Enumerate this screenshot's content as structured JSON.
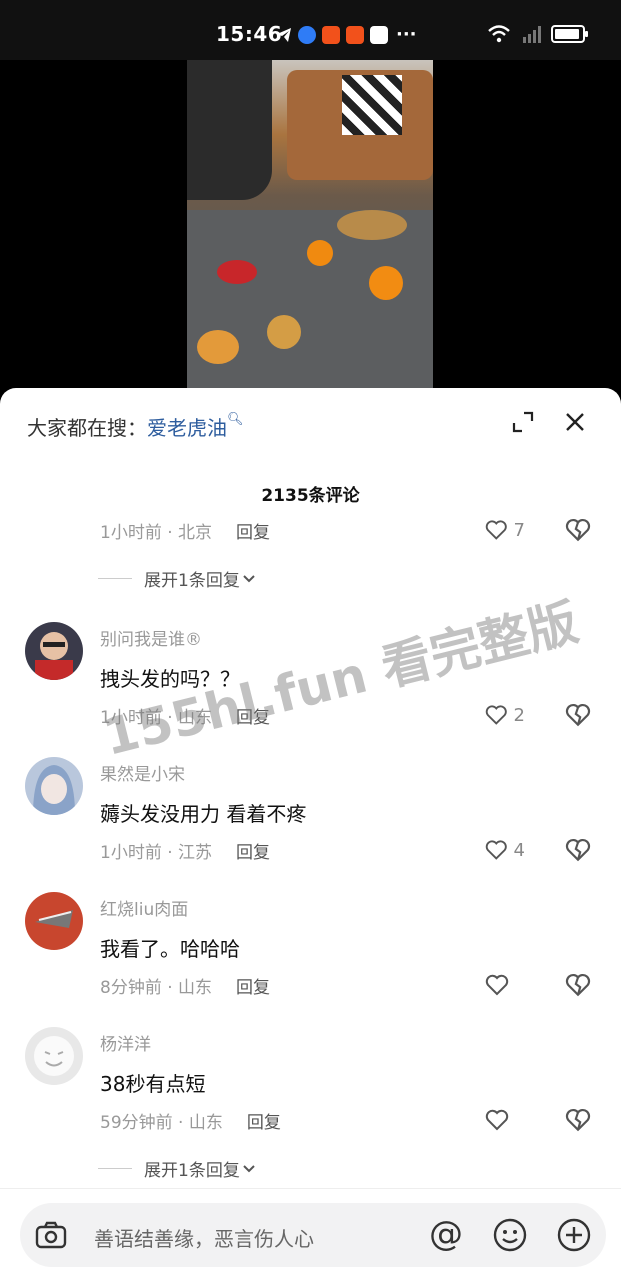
{
  "status_bar": {
    "time": "15:46",
    "more": "···"
  },
  "search": {
    "prefix": "大家都在搜：",
    "keyword": "爱老虎油",
    "search_icon": "search-icon"
  },
  "comment_count": "2135条评论",
  "prev_comment": {
    "time": "1小时前",
    "location": "北京",
    "reply": "回复",
    "likes": "7",
    "expand": "展开1条回复"
  },
  "comments": [
    {
      "username": "别问我是谁®",
      "text": "拽头发的吗？？",
      "time": "1小时前",
      "location": "山东",
      "reply": "回复",
      "likes": "2"
    },
    {
      "username": "果然是小宋",
      "text": "薅头发没用力 看着不疼",
      "time": "1小时前",
      "location": "江苏",
      "reply": "回复",
      "likes": "4"
    },
    {
      "username": "红烧liu肉面",
      "text": "我看了。哈哈哈",
      "time": "8分钟前",
      "location": "山东",
      "reply": "回复",
      "likes": ""
    },
    {
      "username": "杨洋洋",
      "text": "38秒有点短",
      "time": "59分钟前",
      "location": "山东",
      "reply": "回复",
      "likes": "",
      "expand": "展开1条回复"
    }
  ],
  "watermark": "155hl.fun 看完整版",
  "input": {
    "placeholder": "善语结善缘，恶言伤人心",
    "at": "@"
  },
  "colors": {
    "accent": "#2e5d9e",
    "sheet": "#ffffff",
    "muted": "#999999"
  }
}
